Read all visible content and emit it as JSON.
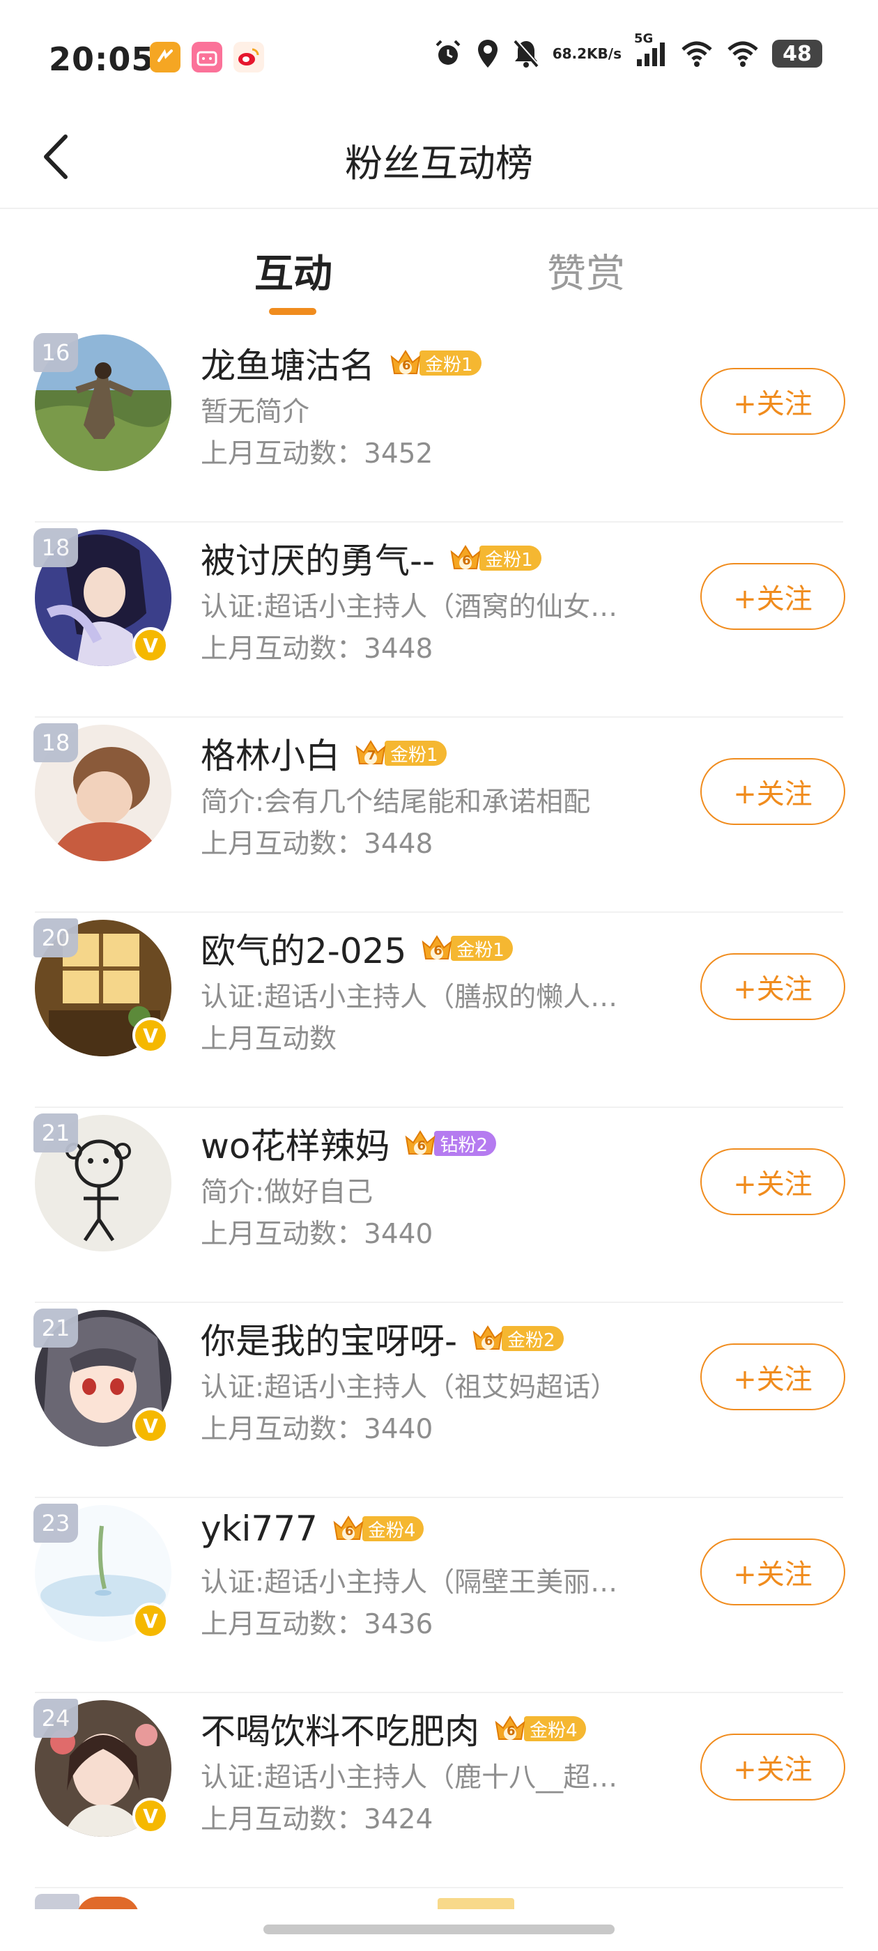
{
  "status_bar": {
    "time": "20:05",
    "net_speed_top": "68.2",
    "net_speed_bottom": "KB/s",
    "network_type": "5G",
    "battery": "48"
  },
  "header": {
    "title": "粉丝互动榜"
  },
  "tabs": [
    {
      "label": "互动",
      "active": true
    },
    {
      "label": "赞赏",
      "active": false
    }
  ],
  "users": [
    {
      "rank": "16",
      "name": "龙鱼塘沽名",
      "crown_level": "6",
      "fan_label": "金粉1",
      "fan_type": "gold",
      "verified": false,
      "bio": "暂无简介",
      "count": "上月互动数：3452",
      "follow": "+关注"
    },
    {
      "rank": "18",
      "name": "被讨厌的勇气--",
      "crown_level": "6",
      "fan_label": "金粉1",
      "fan_type": "gold",
      "verified": true,
      "bio": "认证:超话小主持人（酒窝的仙女…",
      "count": "上月互动数：3448",
      "follow": "+关注"
    },
    {
      "rank": "18",
      "name": "格林小白",
      "crown_level": "7",
      "fan_label": "金粉1",
      "fan_type": "gold",
      "verified": false,
      "bio": "简介:会有几个结尾能和承诺相配",
      "count": "上月互动数：3448",
      "follow": "+关注"
    },
    {
      "rank": "20",
      "name": "欧气的2-025",
      "crown_level": "6",
      "fan_label": "金粉1",
      "fan_type": "gold",
      "verified": true,
      "bio": "认证:超话小主持人（膳叔的懒人…",
      "count": "上月互动数",
      "follow": "+关注"
    },
    {
      "rank": "21",
      "name": "wo花样辣妈",
      "crown_level": "6",
      "fan_label": "钻粉2",
      "fan_type": "diamond",
      "verified": false,
      "bio": "简介:做好自己",
      "count": "上月互动数：3440",
      "follow": "+关注"
    },
    {
      "rank": "21",
      "name": "你是我的宝呀呀-",
      "crown_level": "6",
      "fan_label": "金粉2",
      "fan_type": "gold",
      "verified": true,
      "bio": "认证:超话小主持人（祖艾妈超话）",
      "count": "上月互动数：3440",
      "follow": "+关注"
    },
    {
      "rank": "23",
      "name": "yki777",
      "crown_level": "6",
      "fan_label": "金粉4",
      "fan_type": "gold",
      "verified": true,
      "bio": "认证:超话小主持人（隔壁王美丽…",
      "count": "上月互动数：3436",
      "follow": "+关注"
    },
    {
      "rank": "24",
      "name": "不喝饮料不吃肥肉",
      "crown_level": "6",
      "fan_label": "金粉4",
      "fan_type": "gold",
      "verified": true,
      "bio": "认证:超话小主持人（鹿十八__超…",
      "count": "上月互动数：3424",
      "follow": "+关注"
    }
  ],
  "colors": {
    "accent": "#f08c1e",
    "gold_badge": "#f5b731",
    "diamond_badge": "#b57bf0",
    "verified": "#f5b800"
  }
}
